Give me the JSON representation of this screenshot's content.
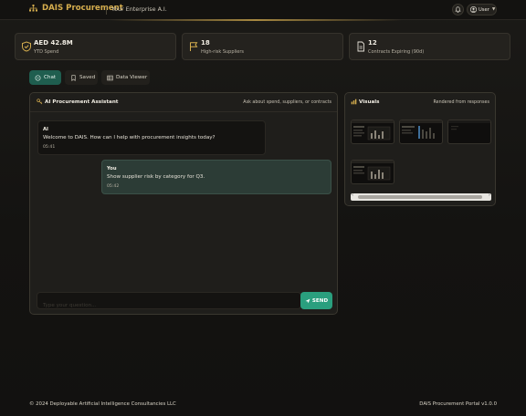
{
  "header": {
    "brand": "DAIS Procurement",
    "tagline": "Your Enterprise A.I.",
    "user_label": "User"
  },
  "kpis": [
    {
      "value": "AED 42.8M",
      "label": "YTD Spend",
      "icon": "shield-icon"
    },
    {
      "value": "18",
      "label": "High-risk Suppliers",
      "icon": "flag-icon"
    },
    {
      "value": "12",
      "label": "Contracts Expiring (90d)",
      "icon": "document-icon"
    }
  ],
  "tabs": [
    {
      "label": "Chat",
      "icon": "chat-icon",
      "active": true
    },
    {
      "label": "Saved",
      "icon": "bookmark-icon",
      "active": false
    },
    {
      "label": "Data Viewer",
      "icon": "table-icon",
      "active": false
    }
  ],
  "chat": {
    "title": "AI Procurement Assistant",
    "hint": "Ask about spend, suppliers, or contracts",
    "messages": [
      {
        "sender": "AI",
        "text": "Welcome to DAIS. How can I help with procurement insights today?",
        "time": "05:41"
      },
      {
        "sender": "You",
        "text": "Show supplier risk by category for Q3.",
        "time": "05:42"
      }
    ],
    "input_placeholder": "Type your question...",
    "send_label": "SEND"
  },
  "visuals": {
    "title": "Visuals",
    "hint": "Rendered from responses",
    "thumbnail_count": 4
  },
  "footer": {
    "copyright": "© 2024 Deployable Artificial Intelligence Consultancies LLC",
    "version": "DAIS Procurement Portal v1.0.0"
  },
  "colors": {
    "accent_gold": "#d6ae4e",
    "accent_green": "#2a9f7e",
    "background": "#141311"
  }
}
